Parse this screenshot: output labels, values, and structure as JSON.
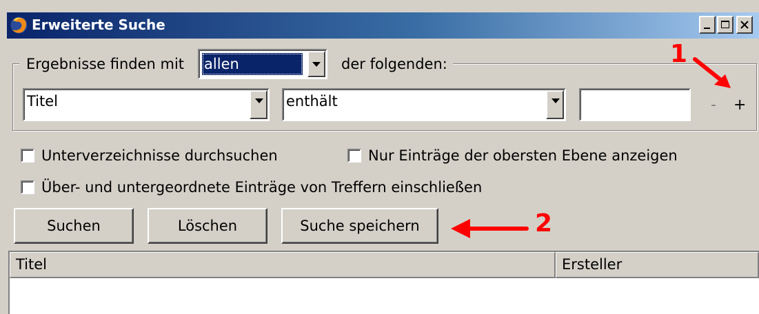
{
  "window": {
    "title": "Erweiterte Suche",
    "controls": {
      "minimize": "minimize-icon",
      "maximize": "maximize-icon",
      "close": "close-icon"
    }
  },
  "match": {
    "prefix": "Ergebnisse finden mit",
    "selected": "allen",
    "suffix": "der folgenden:"
  },
  "rule": {
    "field": "Titel",
    "operator": "enthält",
    "value": "",
    "remove_label": "-",
    "add_label": "+"
  },
  "options": {
    "subfolders": "Unterverzeichnisse durchsuchen",
    "top_level": "Nur Einträge der obersten Ebene anzeigen",
    "include_related": "Über- und untergeordnete Einträge von Treffern einschließen"
  },
  "buttons": {
    "search": "Suchen",
    "clear": "Löschen",
    "save": "Suche speichern"
  },
  "results": {
    "columns": [
      "Titel",
      "Ersteller"
    ]
  },
  "annotations": {
    "marker_1": "1",
    "marker_2": "2",
    "color": "#ff0000"
  }
}
